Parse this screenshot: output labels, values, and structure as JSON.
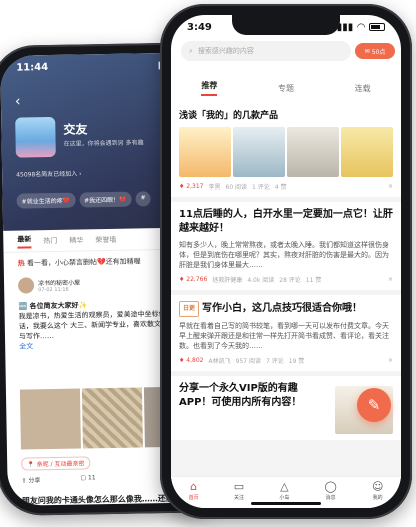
{
  "back_phone": {
    "time": "11:44",
    "circle_title": "交友",
    "circle_subtitle": "在这里，你将会遇到另 多有趣",
    "stats": "45098名简友已经加入 ›",
    "tags": [
      "#就业生活的疼💔",
      "#我还四眼！💔",
      "#"
    ],
    "tabs": [
      "最新",
      "热门",
      "精华",
      "荣誉墙"
    ],
    "hot_prefix": "热",
    "hot_text": "看一看，小心禁言删帖💔还有加精喔",
    "user_name": "凉书的秘密小屋",
    "user_date": "07-02 11:16",
    "post_title": "🆕 各位简友大家好✨",
    "post_body": "我是凉书，热爱生活的观察员，爱美途中坐标仙东，也有一些话，我要么这个 大三、新闻学专业，喜欢散文、诗歌、摄影与写作……",
    "post_more": "全文",
    "location": "📍 亲昵 / 互动最亲密",
    "share": "分享",
    "comments": "11",
    "post2_title": "朋友问我的卡通头像怎么那么像我……还能给我的照片画他出来吗"
  },
  "front_phone": {
    "time": "3:49",
    "search_placeholder": "搜索感兴趣的内容",
    "coin_label": "50点",
    "tabs": [
      "推荐",
      "专题",
      "连载"
    ],
    "cards": [
      {
        "title": "浅谈「我的」的几款产品",
        "likes": "2,317",
        "author": "李黑",
        "views": "60 阅读",
        "comments": "1 评论",
        "rewards": "4 赞"
      },
      {
        "title": "11点后睡的人，白开水里一定要加一点它！让肝越来越好！",
        "excerpt": "知有多少人，晚上常常熬夜，或者太晚入睡。我们都知道这样很伤身体，但是到底伤在哪里呢？其实，熬夜对肝脏的伤害是最大的。因为肝脏是我们身体里最大……",
        "likes": "22,766",
        "author": "拯救肝健康",
        "views": "4.0k 阅读",
        "comments": "28 评论",
        "rewards": "11 赞"
      },
      {
        "badge": "日更",
        "title": "写作小白，这几点技巧很适合你哦！",
        "excerpt": "早就在看着自己写的简书较笔，看到哪一天可以发布付费文章。今天早上醒来弹开跟还是和往常一样先打开简书看成赞、看评论，看关注数。也看到了今天我的……",
        "likes": "4,802",
        "author": "A林凯飞",
        "views": "957 阅读",
        "comments": "7 评论",
        "rewards": "19 赞"
      },
      {
        "title": "分享一个永久VIP版的有趣APP！可使用内所有内容！"
      }
    ],
    "nav": [
      "首页",
      "关注",
      "小岛",
      "消息",
      "我的"
    ]
  }
}
